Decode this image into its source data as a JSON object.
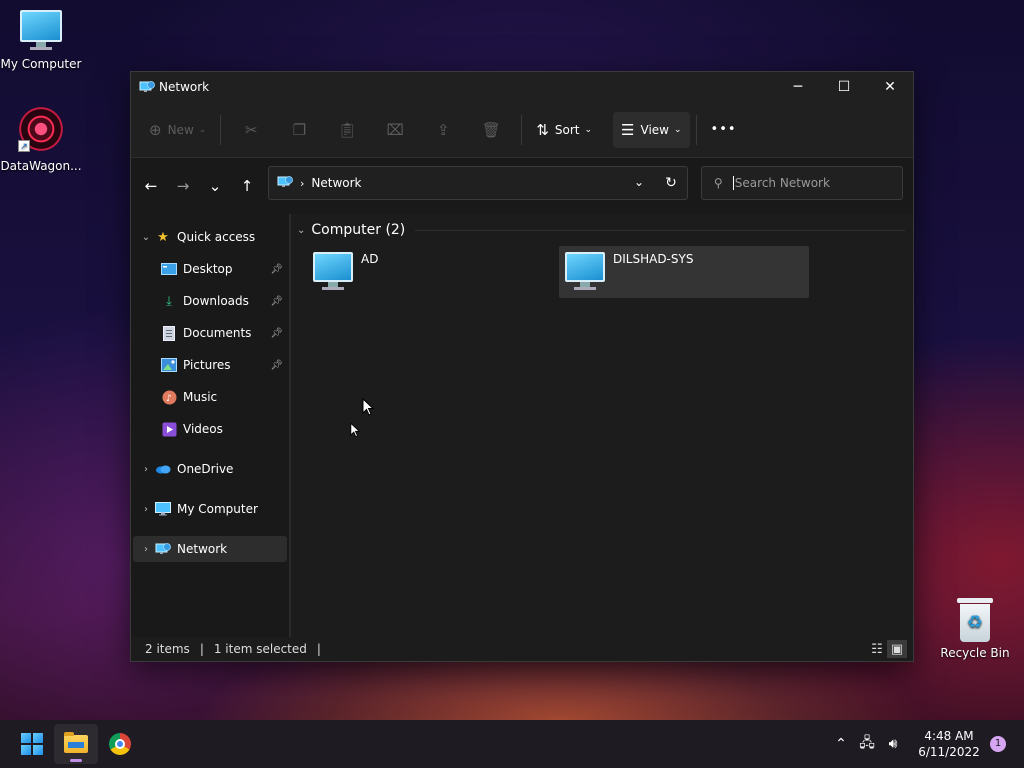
{
  "desktop": {
    "icons": [
      {
        "label": "My Computer",
        "icon": "monitor-icon"
      },
      {
        "label": "DataWagon...",
        "icon": "datawagon-icon"
      },
      {
        "label": "Recycle Bin",
        "icon": "recycle-bin-icon"
      }
    ]
  },
  "window": {
    "title": "Network",
    "controls": {
      "minimize": "─",
      "maximize": "☐",
      "close": "✕"
    }
  },
  "toolbar": {
    "new_label": "New",
    "sort_label": "Sort",
    "view_label": "View",
    "more_label": "•••",
    "actions": [
      "cut-icon",
      "copy-icon",
      "paste-icon",
      "rename-icon",
      "share-icon",
      "delete-icon"
    ]
  },
  "navigation": {
    "back": "←",
    "forward": "→",
    "recent": "⌄",
    "up": "↑"
  },
  "address": {
    "separator": "›",
    "crumb": "Network",
    "dropdown": "⌄",
    "refresh": "↻"
  },
  "search": {
    "placeholder": "Search Network"
  },
  "sidebar": {
    "quick_access": "Quick access",
    "items": [
      {
        "label": "Desktop",
        "pinned": true
      },
      {
        "label": "Downloads",
        "pinned": true
      },
      {
        "label": "Documents",
        "pinned": true
      },
      {
        "label": "Pictures",
        "pinned": true
      },
      {
        "label": "Music",
        "pinned": false
      },
      {
        "label": "Videos",
        "pinned": false
      }
    ],
    "onedrive": "OneDrive",
    "my_computer": "My Computer",
    "network": "Network"
  },
  "content": {
    "group_header": "Computer (2)",
    "items": [
      {
        "name": "AD",
        "selected": false
      },
      {
        "name": "DILSHAD-SYS",
        "selected": true
      }
    ]
  },
  "status": {
    "count": "2 items",
    "selected": "1 item selected",
    "separator": "|"
  },
  "taskbar": {
    "time": "4:48 AM",
    "date": "6/11/2022",
    "notification_count": "1",
    "tray_icons": [
      "chevron-up-icon",
      "network-icon",
      "volume-icon"
    ]
  },
  "colors": {
    "accent": "#c090e8",
    "window_bg": "#1c1c1c",
    "selected_bg": "#343434"
  }
}
